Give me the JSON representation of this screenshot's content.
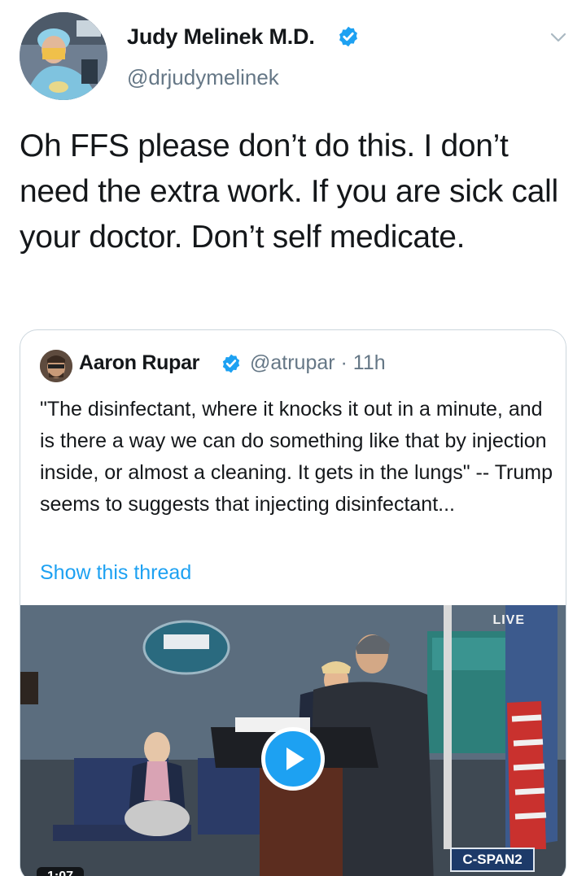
{
  "tweet": {
    "author_name": "Judy Melinek M.D.",
    "author_handle": "@drjudymelinek",
    "text": "Oh FFS please don’t do this. I don’t need the extra work. If you are sick call your doctor. Don’t self medicate."
  },
  "quoted_tweet": {
    "author_name": "Aaron Rupar",
    "author_handle": "@atrupar · 11h",
    "text": "\"The disinfectant, where it knocks it out in a minute, and is there a way we can do something like that by injection inside, or almost a cleaning. It gets in the lungs\" -- Trump seems to suggests that injecting disinfectant...",
    "show_thread_label": "Show this thread",
    "video": {
      "live_label": "LIVE",
      "network_label": "C-SPAN2",
      "duration": "1:07"
    }
  },
  "icons": {
    "verified": "verified-badge-icon",
    "caret": "chevron-down-icon",
    "play": "play-icon"
  },
  "colors": {
    "link_blue": "#1da1f2",
    "text_primary": "#14171a",
    "text_secondary": "#657786",
    "border": "#ccd6dd"
  }
}
